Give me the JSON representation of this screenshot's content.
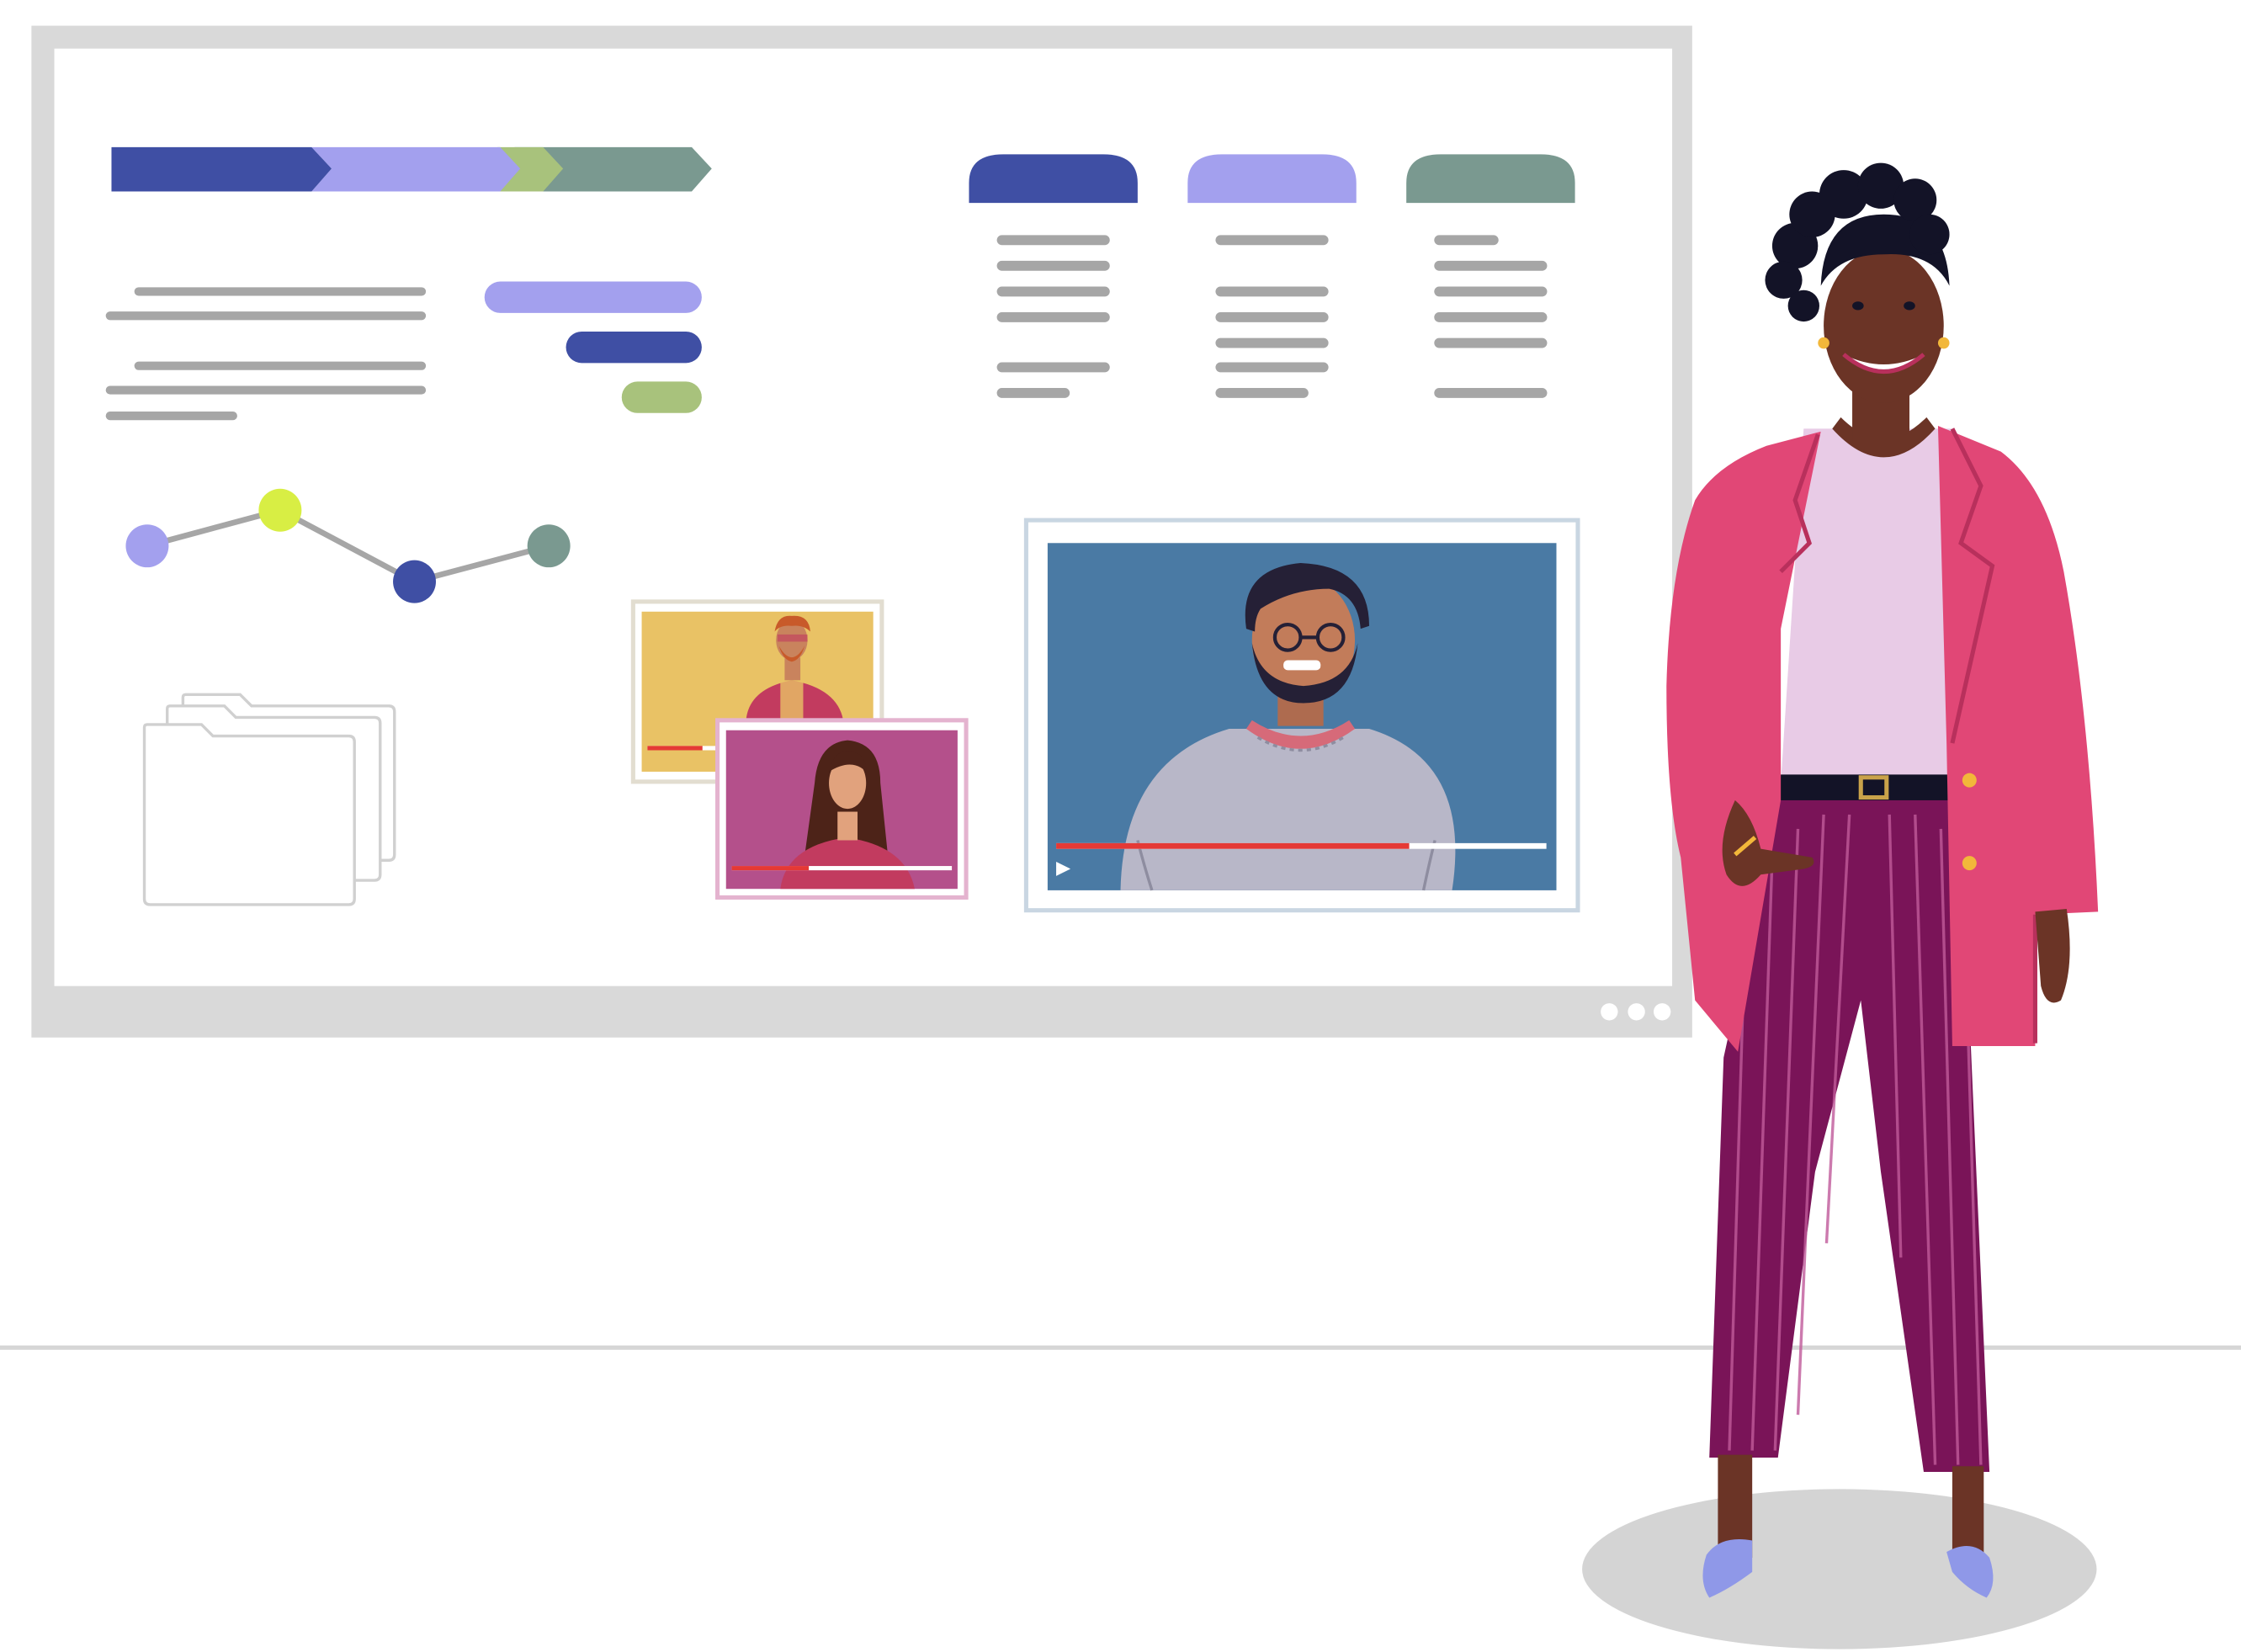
{
  "colors": {
    "background": "#ffffff",
    "board_frame": "#d9d9d9",
    "board_inner": "#ffffff",
    "floor_line": "#d6d6d6",
    "navy": "#3f4fa4",
    "lavender": "#a3a0ee",
    "sage": "#7a9990",
    "lime": "#a8c27c",
    "yellow_green": "#d8ee44",
    "text_gray": "#a6a6a6",
    "video_blue": "#4a7aa4",
    "video_yellow": "#e9c265",
    "video_pink": "#b4508b",
    "progress_red": "#e53935",
    "blazer_pink": "#e14776",
    "pants_plum": "#7a1458",
    "skin": "#6b3426",
    "hair": "#131327",
    "shirt_lilac": "#e8cbe6",
    "shoe_blue": "#8f98e8",
    "shadow_gray": "#d4d4d4"
  },
  "icons": {
    "dots": "more-dots-icon",
    "folder": "folder-stack-icon",
    "play": "play-icon"
  },
  "board": {
    "dot_count": 3,
    "main_video_progress": 0.72,
    "small_video_progress": 0.25,
    "pink_video_progress": 0.35
  },
  "line_chart": {
    "points": [
      1,
      2.2,
      0,
      1.6
    ]
  },
  "column_headers": [
    "navy",
    "lavender",
    "sage"
  ]
}
